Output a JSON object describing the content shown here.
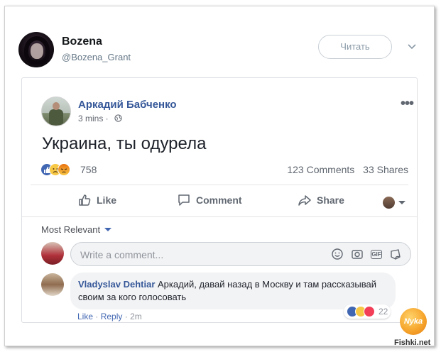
{
  "tweet": {
    "name": "Bozena",
    "handle": "@Bozena_Grant",
    "follow_label": "Читать"
  },
  "post": {
    "author": "Аркадий Бабченко",
    "time": "3 mins ·",
    "text": "Украина, ты одурела",
    "reactions_count": "758",
    "comments": "123 Comments",
    "shares": "33 Shares",
    "actions": {
      "like": "Like",
      "comment": "Comment",
      "share": "Share"
    },
    "sort_label": "Most Relevant",
    "comment_placeholder": "Write a comment...",
    "gif_label": "GIF"
  },
  "comment": {
    "author": "Vladyslav Dehtiar",
    "text": "Аркадий, давай назад в Москву и там рассказывай своим за кого голосовать",
    "reactions_count": "22",
    "like": "Like",
    "reply": "Reply",
    "time": "2m"
  },
  "watermark": {
    "logo": "Nyka",
    "site": "Fishki.net"
  },
  "colors": {
    "fb_blue": "#365899",
    "like_blue": "#4267b2",
    "muted": "#606770"
  }
}
